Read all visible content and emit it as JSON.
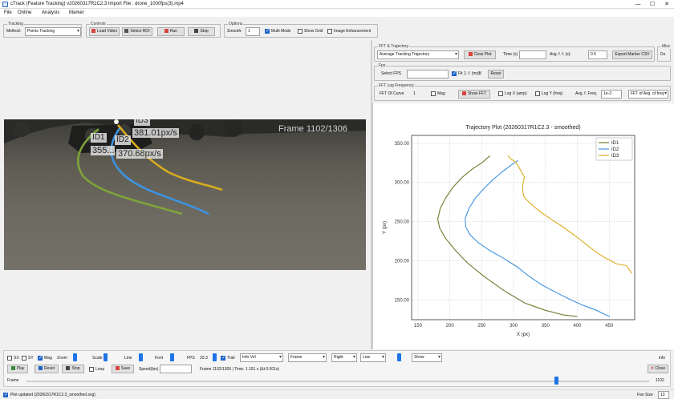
{
  "window": {
    "title": "cTrack (Feature Tracking) v20260317R1C2.3 Import File : drone_1000fps(3).mp4",
    "min": "—",
    "max": "☐",
    "close": "✕"
  },
  "menu": [
    "File",
    "Online",
    "Analysis",
    "Marker"
  ],
  "tracking": {
    "group": "Tracking",
    "method_label": "Method:",
    "method_value": "Points Tracking"
  },
  "controls": {
    "group": "Controls",
    "load_video": "Load Video",
    "select_roi": "Select ROI",
    "run": "Run",
    "stop": "Stop"
  },
  "options": {
    "group": "Options",
    "smooth_label": "Smooth:",
    "smooth_value": "1",
    "multi_mode": "Multi Mode",
    "show_grid": "Show Grid",
    "image_enhancement": "Image Enhancement"
  },
  "trajectory": {
    "group": "FFT & Trajectory",
    "plot_type": "Average Tracking Trajectory",
    "clear_plot": "Clear Plot",
    "time_label": "Time (s)",
    "time_value": "",
    "from_label": "Avg. f. f. (s):",
    "from_value": "0.5",
    "export_button": "Export Marker CSV"
  },
  "misc": {
    "group": "Misc",
    "field": "Do"
  },
  "fps": {
    "group": "Fps",
    "label": "Select FPS",
    "value": "",
    "check_label": "Fit 1. f. (ms):",
    "check_value": "5",
    "reset": "Reset"
  },
  "fft": {
    "group": "FFT Log Frequency",
    "fft_label": "FFT Of Curve",
    "fft_flag": "1",
    "mag_label": "Mag",
    "show_fft": "Show FFT",
    "log_x": "Log X (amp)",
    "log_y": "Log Y (freq)",
    "avg_label": "Avg. f. Freq.",
    "avg_value": "1e-3",
    "fft_value": "FFT of Avg. of freq"
  },
  "video": {
    "frame": "Frame 1102/1306",
    "tags": [
      {
        "id": "ID3"
      },
      {
        "id": "ID1"
      },
      {
        "id": "ID2"
      },
      {
        "speed": "381.01px/s"
      },
      {
        "speed": "370.68px/s"
      },
      {
        "speed": "355..."
      }
    ]
  },
  "chart_data": {
    "type": "line",
    "title": "Trajectory Plot (20260317R1C2.3 - smoothed)",
    "xlabel": "X (px)",
    "ylabel": "Y (px)",
    "xlim": [
      140,
      490
    ],
    "ylim": [
      125,
      360
    ],
    "xticks": [
      "150",
      "200",
      "250",
      "300",
      "350",
      "400",
      "450"
    ],
    "yticks": [
      "150.00",
      "200.00",
      "250.00",
      "300.00",
      "350.00"
    ],
    "xtick_values": [
      150,
      200,
      250,
      300,
      350,
      400,
      450
    ],
    "ytick_values": [
      150,
      200,
      250,
      300,
      350
    ],
    "grid": true,
    "legend": "top-right",
    "series": [
      {
        "name": "ID1",
        "color": "#6b7a2a",
        "x": [
          263,
          250,
          235,
          220,
          205,
          194,
          185,
          181,
          184,
          193,
          208,
          228,
          254,
          285,
          318,
          350,
          378,
          400
        ],
        "y": [
          334,
          325,
          317,
          307,
          294,
          281,
          267,
          253,
          242,
          229,
          214,
          197,
          180,
          162,
          146,
          137,
          131,
          129
        ]
      },
      {
        "name": "ID2",
        "color": "#3d93e0",
        "x": [
          307,
          296,
          283,
          268,
          253,
          240,
          230,
          224,
          225,
          232,
          245,
          263,
          285,
          306,
          325,
          345,
          366,
          388,
          407,
          420,
          430,
          440,
          451
        ],
        "y": [
          328,
          322,
          314,
          304,
          292,
          280,
          267,
          254,
          243,
          233,
          223,
          213,
          203,
          192,
          180,
          169,
          160,
          151,
          144,
          140,
          137,
          133,
          129
        ]
      },
      {
        "name": "ID3",
        "color": "#d9ac1e",
        "x": [
          291,
          296,
          303,
          310,
          317,
          315,
          314,
          316,
          324,
          338,
          357,
          380,
          403,
          425,
          441,
          453,
          462,
          470,
          477,
          482,
          486
        ],
        "y": [
          334,
          330,
          326,
          317,
          307,
          300,
          291,
          282,
          275,
          265,
          254,
          242,
          228,
          214,
          205,
          200,
          196,
          195,
          194,
          188,
          184
        ]
      }
    ]
  },
  "playback": {
    "row1": {
      "sx": "SX",
      "sy": "SY",
      "mag": "Mag",
      "zoom": "Zoom",
      "scale": "Scale",
      "line": "Line",
      "font": "Font",
      "fps_label": "FPS",
      "fps_value": "33.3",
      "trail": "Trail",
      "info": "Info Vel",
      "frame_mode": "Frame",
      "r1": "Right",
      "r2": "Low",
      "r3": "Show"
    },
    "row2": {
      "play": "Play",
      "reset": "Reset",
      "stop": "Stop",
      "loop": "Loop",
      "save": "Save",
      "speed_label": "Speed(fps)",
      "speed_value": "",
      "frame_info": "Frame 1102/1306 | Time: 1.101 s (Δt 0.001s)"
    },
    "close": "Close",
    "frame_left": "Frame",
    "frame_right": "1102",
    "right_label": "info"
  },
  "status": {
    "text": "Plot updated (20260317R1C2.3_smoothed.svg)",
    "zoom_label": "Fan Size",
    "zoom_value": "13"
  }
}
